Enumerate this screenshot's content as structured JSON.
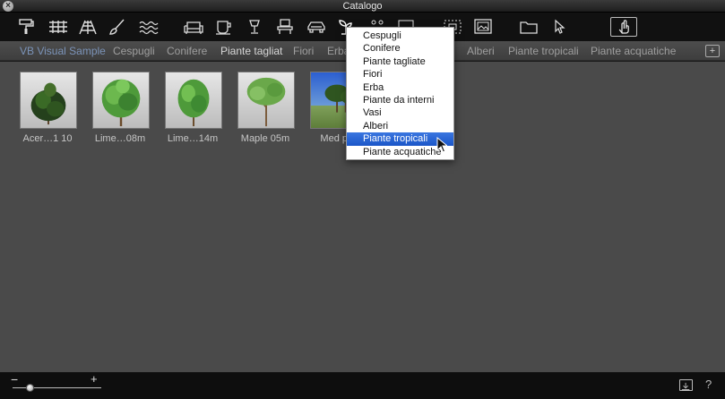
{
  "window": {
    "title": "Catalogo",
    "close_glyph": "×"
  },
  "toolbar": {
    "tools": [
      {
        "name": "paint-roller-icon"
      },
      {
        "name": "railing-icon"
      },
      {
        "name": "stairs-icon"
      },
      {
        "name": "brush-icon"
      },
      {
        "name": "water-waves-icon"
      },
      {
        "name": "sofa-icon"
      },
      {
        "name": "cup-icon"
      },
      {
        "name": "lamp-icon"
      },
      {
        "name": "chair-icon"
      },
      {
        "name": "car-icon"
      },
      {
        "name": "plant-icon"
      },
      {
        "name": "people-icon"
      },
      {
        "name": "image-icon"
      },
      {
        "name": "selection-frame-icon"
      },
      {
        "name": "picture-frame-icon"
      },
      {
        "name": "folder-icon"
      },
      {
        "name": "pointer-icon"
      },
      {
        "name": "hand-icon"
      }
    ]
  },
  "categories": [
    {
      "label": "VB Visual Sample",
      "state": "active"
    },
    {
      "label": "Cespugli"
    },
    {
      "label": "Conifere"
    },
    {
      "label": "Piante tagliat",
      "state": "selected"
    },
    {
      "label": "Fiori"
    },
    {
      "label": "Erba"
    },
    {
      "label": "Alberi"
    },
    {
      "label": "Piante tropicali"
    },
    {
      "label": "Piante acquatiche"
    }
  ],
  "add_folder_glyph": "+",
  "items": [
    {
      "label": "Acer…1 10"
    },
    {
      "label": "Lime…08m"
    },
    {
      "label": "Lime…14m"
    },
    {
      "label": "Maple 05m"
    },
    {
      "label": "Med pin"
    }
  ],
  "dropdown": {
    "items": [
      "Cespugli",
      "Conifere",
      "Piante tagliate",
      "Fiori",
      "Erba",
      "Piante da interni",
      "Vasi",
      "Alberi",
      "Piante tropicali",
      "Piante acquatiche"
    ],
    "highlighted": "Piante tropicali"
  },
  "bottombar": {
    "zoom_minus": "−",
    "zoom_plus": "+",
    "help": "?",
    "zoom_level": 0.15
  },
  "colors": {
    "highlight": "#2463d6",
    "active_category": "#7b93b8"
  }
}
